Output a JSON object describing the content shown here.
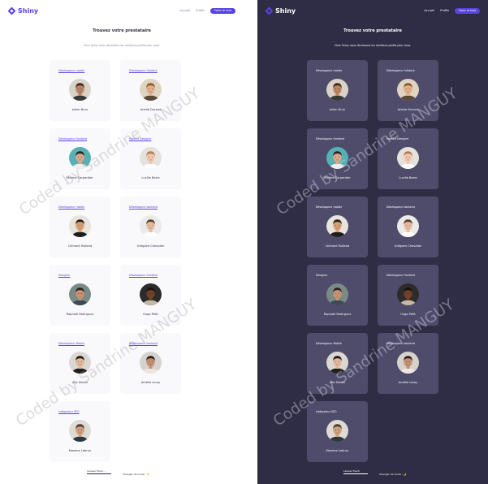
{
  "app": {
    "logo_text": "Shiny",
    "nav": {
      "home": "Accueil",
      "profiles": "Profils",
      "test": "Faire le test"
    },
    "title": "Trouvez votre prestataire",
    "subtitle": "Chez Shiny nous réunissons les meilleurs profils pour vous.",
    "watermark": "Coded by Sandrine MANGUY",
    "footer": {
      "input_value": "Laissez Feedi...",
      "dark_input_value": "Laissez Feedi",
      "toggle_light": "Changer de mode : ☀️",
      "toggle_dark": "Changer de mode : 🌙"
    }
  },
  "profiles": [
    {
      "job": "Développeur mobile",
      "job_light": "Développeur mobile",
      "name": "Julien Brun",
      "skin": "#b98462",
      "hair": "#3a2a22",
      "bg": "#d9d2c8",
      "shirt": "#3b3a3a"
    },
    {
      "job": "Développeur fullstack",
      "job_light": "Développeur fullstack",
      "name": "Arielle Durand",
      "skin": "#e0b08c",
      "hair": "#8c5a2b",
      "bg": "#dfd3c2",
      "shirt": "#5b4a3a"
    },
    {
      "job": "Développeur frontend",
      "job_light": "Développeur frontend",
      "name": "Marine Carpentier",
      "skin": "#d9a98a",
      "hair": "#2f2420",
      "bg": "#55b1b4",
      "shirt": "#efefef"
    },
    {
      "job": "Product Designer",
      "job_light": "Product Designer",
      "name": "Lucille Barre",
      "skin": "#f0c8ad",
      "hair": "#b67c56",
      "bg": "#e5e2de",
      "shirt": "#ffffff"
    },
    {
      "job": "Développeur mobile",
      "job_light": "Développeur mobile",
      "name": "Clément Rolland",
      "skin": "#d7a073",
      "hair": "#2a1f18",
      "bg": "#e7e3dd",
      "shirt": "#1e1e1e"
    },
    {
      "job": "Développeur backend",
      "job_light": "Développeur backend",
      "name": "Grégoire Chevalier",
      "skin": "#e8bca0",
      "hair": "#5a4030",
      "bg": "#eceae8",
      "shirt": "#ffffff"
    },
    {
      "job": "Designer",
      "job_light": "Designer",
      "name": "Raphaël Rodriguez",
      "skin": "#c99273",
      "hair": "#2a2320",
      "bg": "#7a8b86",
      "shirt": "#3c4b55"
    },
    {
      "job": "Développeur frontend",
      "job_light": "Développeur frontend",
      "name": "Hugo Petit",
      "skin": "#6e4128",
      "hair": "#1a1210",
      "bg": "#2c2a2a",
      "shirt": "#c4b9a5"
    },
    {
      "job": "Développeur Mobile",
      "job_light": "Développeur Mobile",
      "name": "Alix Simon",
      "skin": "#e3b79a",
      "hair": "#1e1818",
      "bg": "#dbd7d3",
      "shirt": "#202020"
    },
    {
      "job": "Développeur backend",
      "job_light": "Développeur backend",
      "name": "Amélie Leroy",
      "skin": "#c69077",
      "hair": "#2d1f1a",
      "bg": "#d6d3ce",
      "shirt": "#ece7de"
    },
    {
      "job": "Intégrateur SEO",
      "job_light": "Intégrateur SEO",
      "name": "Maxime Lebrun",
      "skin": "#cfa07e",
      "hair": "#4d3a2b",
      "bg": "#dedad5",
      "shirt": "#2c3a3f"
    }
  ]
}
